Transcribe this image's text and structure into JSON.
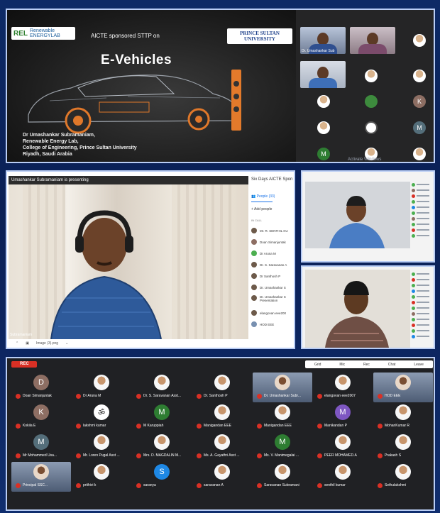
{
  "slide": {
    "lab_logo_mark": "REL",
    "lab_logo_text": "Renewable ENERGYLAB",
    "sponsor_text": "AICTE sponsored STTP on",
    "university_logo": "PRINCE SULTAN UNIVERSITY",
    "title": "E-Vehicles",
    "presenter_lines": [
      "Dr Umashankar Subramaniam,",
      "Renewable Energy Lab,",
      "College of Engineering, Prince Sultan University",
      "Riyadh,  Saudi Arabia"
    ]
  },
  "gallery_top": {
    "tiles": [
      {
        "name": "Dr. Umashankar Sub"
      },
      {
        "name": ""
      },
      {
        "name": ""
      }
    ],
    "avatars": [
      "K",
      "M",
      "M"
    ],
    "watermark": "Activate Windows"
  },
  "meet": {
    "presenting_banner": "Umashankar Subramaniam is presenting",
    "presenter_label": "Subramaniam",
    "bottom_bar_file": "Image (3).png",
    "side_title": "Six Days AICTE Spon",
    "people_tab": "People (33)",
    "add_people": "Add people",
    "in_call": "IN CALL",
    "participants": [
      "Mr. R. SENTHIL KU",
      "Doan Simanjuntak",
      "Dr Aruna M",
      "Dr. S. Saravanan A",
      "Dr Santhosh P",
      "Dr. Umashankar S",
      "Dr. Umashankar S Presentation",
      "elangovan eee200",
      "HOD EEE"
    ]
  },
  "participants_gallery": {
    "rec_label": "REC",
    "toolbar_items": [
      "Grid",
      "Mic",
      "Rec",
      "Chat",
      "Leave"
    ],
    "tiles": [
      {
        "initial": "D",
        "color": "#8d6e63",
        "label": "Doan Simanjuntak"
      },
      {
        "initial": "",
        "color": "#4caf50",
        "label": "Dr Aruna M"
      },
      {
        "initial": "",
        "color": "#ffffff",
        "label": "Dr. S. Saravanan Asst..."
      },
      {
        "initial": "",
        "color": "#ffffff",
        "label": "Dr. Santhosh P"
      },
      {
        "initial": "",
        "color": "#7890b0",
        "label": "Dr. Umashankar Subr..."
      },
      {
        "initial": "",
        "color": "#ffffff",
        "label": "elangovan eee2007"
      },
      {
        "initial": "",
        "color": "#7890b0",
        "label": "HOD EEE"
      },
      {
        "initial": "K",
        "color": "#8d6e63",
        "label": "Kokila E"
      },
      {
        "initial": "ॐ",
        "color": "#ffffff",
        "label": "lakshmi kumar"
      },
      {
        "initial": "M",
        "color": "#2e7d32",
        "label": "M Karuppiah"
      },
      {
        "initial": "",
        "color": "#ffffff",
        "label": "Manigandan EEE"
      },
      {
        "initial": "",
        "color": "#ffffff",
        "label": "Manigandan EEE"
      },
      {
        "initial": "M",
        "color": "#7e57c2",
        "label": "Manikandan P"
      },
      {
        "initial": "",
        "color": "#ffffff",
        "label": "MohanKumar R"
      },
      {
        "initial": "M",
        "color": "#546e7a",
        "label": "Mr Mohammed Usa..."
      },
      {
        "initial": "",
        "color": "#ffffff",
        "label": "Mr. Loren Pugal Asst ..."
      },
      {
        "initial": "",
        "color": "#ffffff",
        "label": "Mrs. D. MAGDALIN M..."
      },
      {
        "initial": "",
        "color": "#ffffff",
        "label": "Ms. A. Gayathri Asst ..."
      },
      {
        "initial": "M",
        "color": "#2e7d32",
        "label": "Ms. V. Manimegalai ..."
      },
      {
        "initial": "",
        "color": "#ffffff",
        "label": "PEER MOHAMED.A"
      },
      {
        "initial": "",
        "color": "#ffffff",
        "label": "Prakash S"
      },
      {
        "initial": "",
        "color": "#7890b0",
        "label": "Principal SSC..."
      },
      {
        "initial": "",
        "color": "#ffffff",
        "label": "prithivi k"
      },
      {
        "initial": "S",
        "color": "#1e88e5",
        "label": "saranya"
      },
      {
        "initial": "",
        "color": "#ffffff",
        "label": "saravanan A"
      },
      {
        "initial": "",
        "color": "#ffffff",
        "label": "Saravanan Subramani"
      },
      {
        "initial": "",
        "color": "#ffffff",
        "label": "senthil kumar"
      },
      {
        "initial": "",
        "color": "#ffffff",
        "label": "Sethulakshmi"
      }
    ]
  },
  "colors": {
    "rec": "#d93025",
    "frame": "#b9cdf5",
    "meet_link": "#1a73e8"
  }
}
